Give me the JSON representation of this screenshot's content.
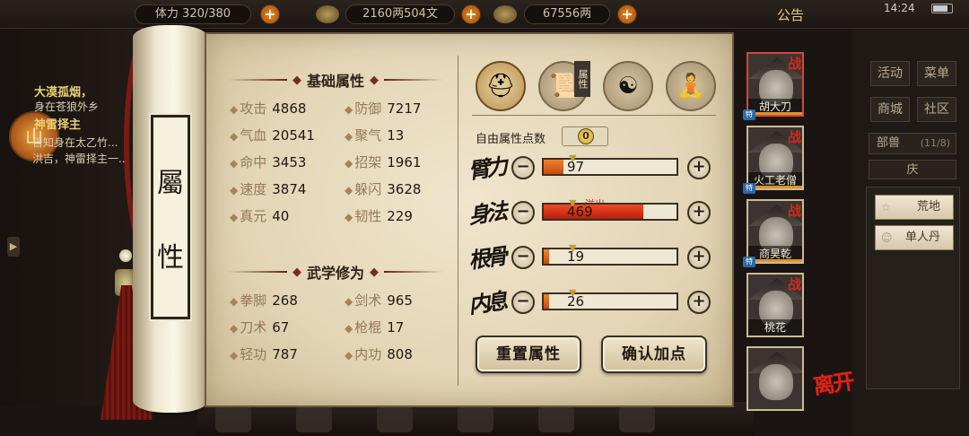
{
  "topbar": {
    "stamina": "体力 320/380",
    "silver_coins": "2160两504文",
    "gold": "67556两",
    "announcement": "公告",
    "time": "14:24"
  },
  "quest": {
    "title": "大漠孤烟，",
    "lines": [
      "身在苍狼外乡",
      "神雷择主",
      "告知身在太乙竹...",
      "洪吉，神雷择主一..."
    ]
  },
  "sidebar_right": {
    "buttons": [
      "活动",
      "菜单",
      "商城",
      "社区"
    ],
    "beast": {
      "label": "部兽",
      "count": "(11/8)"
    },
    "tab": "庆",
    "items": [
      "荒地",
      "单人丹"
    ]
  },
  "scroll": {
    "title_chars": [
      "屬",
      "性"
    ]
  },
  "panel": {
    "basic_title": "基础属性",
    "basic_attrs": [
      {
        "label": "攻击",
        "value": "4868"
      },
      {
        "label": "防御",
        "value": "7217"
      },
      {
        "label": "气血",
        "value": "20541"
      },
      {
        "label": "聚气",
        "value": "13"
      },
      {
        "label": "命中",
        "value": "3453"
      },
      {
        "label": "招架",
        "value": "1961"
      },
      {
        "label": "速度",
        "value": "3874"
      },
      {
        "label": "躲闪",
        "value": "3628"
      },
      {
        "label": "真元",
        "value": "40"
      },
      {
        "label": "韧性",
        "value": "229"
      }
    ],
    "martial_title": "武学修为",
    "martial_attrs": [
      {
        "label": "拳脚",
        "value": "268"
      },
      {
        "label": "剑术",
        "value": "965"
      },
      {
        "label": "刀术",
        "value": "67"
      },
      {
        "label": "枪棍",
        "value": "17"
      },
      {
        "label": "轻功",
        "value": "787"
      },
      {
        "label": "内功",
        "value": "808"
      }
    ],
    "tab_badge": "属性",
    "free_points_label": "自由属性点数",
    "free_points_value": "0",
    "overflow_label": "溢出",
    "stats": [
      {
        "name": "臂力",
        "value": "97",
        "fill": 0.15,
        "overflow": false
      },
      {
        "name": "身法",
        "value": "469",
        "fill": 0.75,
        "overflow": true
      },
      {
        "name": "根骨",
        "value": "19",
        "fill": 0.04,
        "overflow": false
      },
      {
        "name": "内息",
        "value": "26",
        "fill": 0.04,
        "overflow": false
      }
    ],
    "reset_label": "重置属性",
    "confirm_label": "确认加点"
  },
  "party": [
    {
      "name": "胡大刀",
      "war": "战",
      "tag": "特"
    },
    {
      "name": "火工老僧",
      "war": "战",
      "tag": "特"
    },
    {
      "name": "商昊乾",
      "war": "战",
      "tag": "特"
    },
    {
      "name": "桃花",
      "war": "战",
      "tag": ""
    },
    {
      "name": "",
      "war": "",
      "tag": ""
    }
  ],
  "leave_label": "离开",
  "colors": {
    "accent": "#c44d10",
    "overflow": "#b81d0c",
    "war": "#d4281a"
  }
}
